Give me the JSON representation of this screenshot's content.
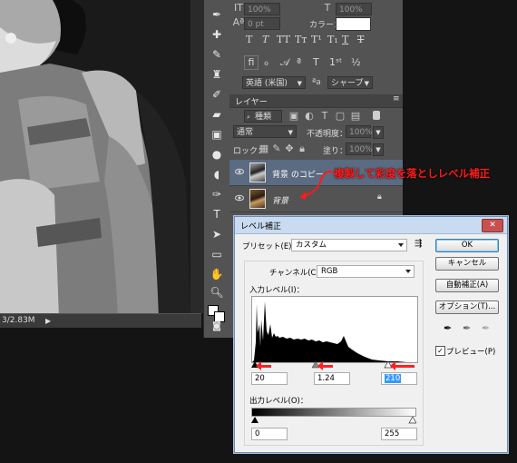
{
  "statusbar": {
    "size_text": "3/2.83M"
  },
  "panel": {
    "opacity_top": "100%",
    "opacity_mid": "100%",
    "pt_value": "0 pt",
    "color_label": "カラー：",
    "lang_value": "英語 (米国)",
    "aa_label": "ªa",
    "aa_value": "シャープ",
    "layers_tab": "レイヤー",
    "kind_value": "種類",
    "blend_mode": "通常",
    "opacity_label": "不透明度：",
    "opacity_value": "100%",
    "lock_label": "ロック：",
    "fill_label": "塗り：",
    "fill_value": "100%",
    "layers": [
      {
        "name": "背景 のコピー",
        "selected": true
      },
      {
        "name": "背景",
        "selected": false
      }
    ]
  },
  "annotation": {
    "text": "複製して彩度を落としレベル補正",
    "color": "#ff1a1a"
  },
  "dialog": {
    "title": "レベル補正",
    "preset_label": "プリセット(E)：",
    "preset_value": "カスタム",
    "channel_label": "チャンネル(C)：",
    "channel_value": "RGB",
    "input_label": "入力レベル(I)：",
    "input_black": "20",
    "input_gamma": "1.24",
    "input_white": "210",
    "output_label": "出力レベル(O)：",
    "output_black": "0",
    "output_white": "255",
    "buttons": {
      "ok": "OK",
      "cancel": "キャンセル",
      "auto": "自動補正(A)",
      "options": "オプション(T)..."
    },
    "preview_label": "プレビュー(P)",
    "preview_checked": true
  }
}
